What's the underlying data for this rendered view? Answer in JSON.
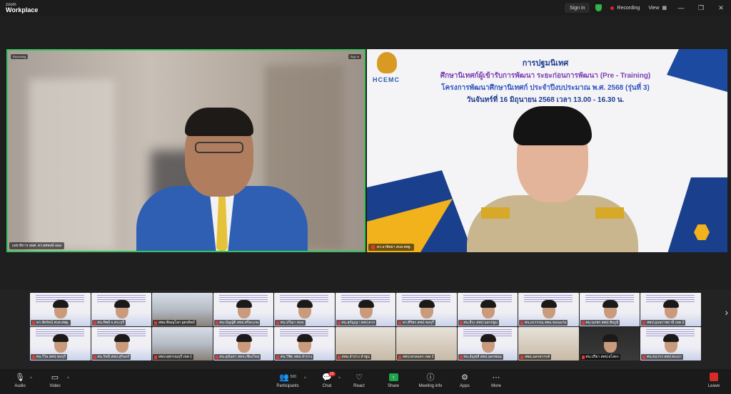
{
  "titlebar": {
    "logo_small": "zoom",
    "logo_main": "Workplace",
    "sign_in": "Sign in",
    "recording": "Recording",
    "view": "View"
  },
  "main": {
    "left_video": {
      "recording_label": "Recording",
      "signin_label": "Sign in",
      "name": "เลขาธิการ สอศ. ดร.ยศพงษ์ ลออ"
    },
    "right_video": {
      "emblem_text": "HCEMC",
      "banner_line1": "การปฐมนิเทศ",
      "banner_line2": "ศึกษานิเทศก์ผู้เข้ารับการพัฒนา ระยะก่อนการพัฒนา (Pre - Training)",
      "banner_line3": "โครงการพัฒนาศึกษานิเทศก์ ประจำปีงบประมาณ พ.ศ. 2568 (รุ่นที่ 3)",
      "banner_line4": "วันจันทร์ที่ 16 มิถุนายน 2568 เวลา 13.00 - 16.30 น.",
      "name": "ดร.อาทิตยา สบส.สพฐ."
    }
  },
  "gallery": {
    "tiles": [
      {
        "name": "ดร.ชัยรัตน์ สบส.สพฐ.",
        "kind": "slide"
      },
      {
        "name": "ศน.ทิพย์ จ.สระบุรี",
        "kind": "slide"
      },
      {
        "name": "สพม.พิษณุโลก อุตรดิตถ์",
        "kind": "room"
      },
      {
        "name": "ศน.บัญญัติ สพป.ศรีสะเกษ",
        "kind": "slide"
      },
      {
        "name": "ศน.ปวีณา สบส.",
        "kind": "slide"
      },
      {
        "name": "ศน.สุกัญญา สพป.ตาก",
        "kind": "slide"
      },
      {
        "name": "ดร.ศิริพร สพป.ชลบุรี",
        "kind": "slide"
      },
      {
        "name": "ศน.ธีระ สพป.นครปฐม",
        "kind": "slide"
      },
      {
        "name": "ศน.อรวรรณ สพม.ขอนแก่น",
        "kind": "slide"
      },
      {
        "name": "ศน.นภพร สพป.ชัยภูมิ",
        "kind": "slide"
      },
      {
        "name": "สพป.อุบลราชธานี เขต 3",
        "kind": "slide"
      },
      {
        "name": "ศน.วิไล สพป.ชลบุรี",
        "kind": "slide"
      },
      {
        "name": "ศน.รัชนี สพป.สุรินทร์",
        "kind": "slide"
      },
      {
        "name": "สพป.สุพรรณบุรี เขต 1",
        "kind": "room"
      },
      {
        "name": "ศน.สุนันทา สพป.เชียงใหม่",
        "kind": "slide"
      },
      {
        "name": "ศน.วิชิต สพป.ลำปาง",
        "kind": "slide"
      },
      {
        "name": "สพม.ลำปาง ลำพูน",
        "kind": "class"
      },
      {
        "name": "สพป.สกลนคร เขต 2",
        "kind": "class"
      },
      {
        "name": "ศน.อัญชลี สพป.นครพนม",
        "kind": "slide"
      },
      {
        "name": "สพม.นครสวรรค์",
        "kind": "class"
      },
      {
        "name": "ศน.ปรียา สพป.ยโสธร",
        "kind": "dark"
      },
      {
        "name": "ศน.ธนากร สพป.พะเยา",
        "kind": "slide"
      }
    ]
  },
  "toolbar": {
    "audio": "Audio",
    "video": "Video",
    "participants": "Participants",
    "participants_count": "500",
    "chat": "Chat",
    "chat_badge": "10",
    "react": "React",
    "share": "Share",
    "meeting_info": "Meeting info",
    "apps": "Apps",
    "more": "More",
    "leave": "Leave"
  },
  "colors": {
    "active_speaker_border": "#37c45a",
    "recording_dot": "#e02424",
    "share_green": "#1ea54b",
    "leave_red": "#d92a2a"
  }
}
